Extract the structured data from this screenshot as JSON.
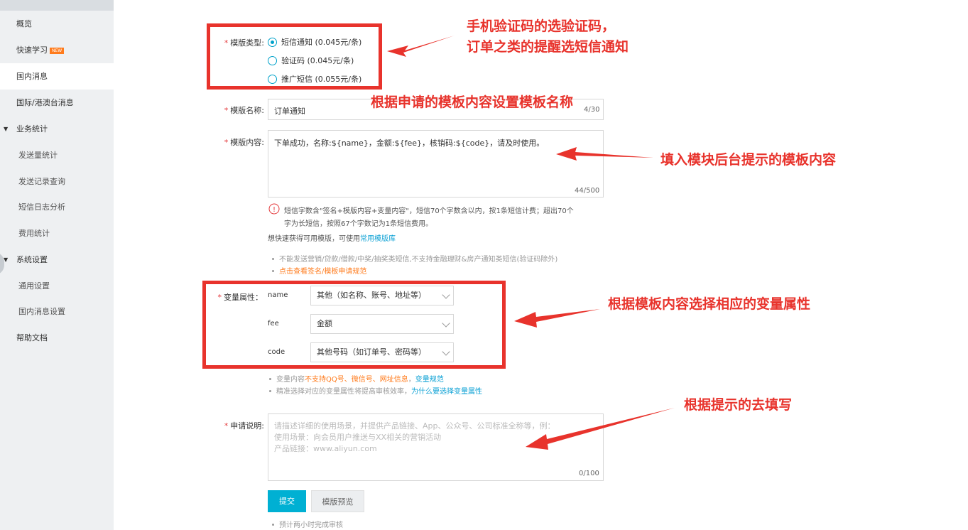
{
  "sidebar": {
    "items": [
      {
        "label": "概览"
      },
      {
        "label": "快速学习",
        "badge": "NEW"
      },
      {
        "label": "国内消息"
      },
      {
        "label": "国际/港澳台消息"
      },
      {
        "label": "业务统计"
      },
      {
        "label": "发送量统计"
      },
      {
        "label": "发送记录查询"
      },
      {
        "label": "短信日志分析"
      },
      {
        "label": "费用统计"
      },
      {
        "label": "系统设置"
      },
      {
        "label": "通用设置"
      },
      {
        "label": "国内消息设置"
      },
      {
        "label": "帮助文档"
      }
    ]
  },
  "form": {
    "required_mark": "*",
    "template_type": {
      "label": "模版类型:",
      "options": [
        "短信通知 (0.045元/条)",
        "验证码 (0.045元/条)",
        "推广短信 (0.055元/条)"
      ],
      "selected": "短信通知 (0.045元/条)"
    },
    "template_name": {
      "label": "模版名称:",
      "value": "订单通知",
      "counter_partial": "4/30"
    },
    "template_content": {
      "label": "模版内容:",
      "value": "下单成功，名称:${name}，金额:${fee}，核销码:${code}，请及时使用。",
      "counter": "44/500"
    },
    "content_tip_line1": "短信字数含\"签名+模版内容+变量内容\"，短信70个字数含以内，按1条短信计费；超出70个",
    "content_tip_line2": "字为长短信，按照67个字数记为1条短信费用。",
    "quick_template_text": "想快速获得可用模版，可使用",
    "quick_template_link": "常用模版库",
    "rule1": "不能发送营销/贷款/借款/中奖/抽奖类短信,不支持金融理财&房产通知类短信(验证码除外)",
    "rule2": "点击查看签名/模板申请规范",
    "variables": {
      "label": "变量属性：",
      "rows": [
        {
          "name": "name",
          "value": "其他（如名称、账号、地址等）"
        },
        {
          "name": "fee",
          "value": "金额"
        },
        {
          "name": "code",
          "value": "其他号码（如订单号、密码等）"
        }
      ]
    },
    "var_tip1_prefix": "变量内容",
    "var_tip1_warn": "不支持QQ号、微信号、网址信息",
    "var_tip1_sep": "，",
    "var_tip1_link": "变量规范",
    "var_tip2_text": "精准选择对应的变量属性将提高审核效率，",
    "var_tip2_link": "为什么要选择变量属性",
    "application": {
      "label": "申请说明:",
      "placeholder_line1": "请描述详细的使用场景，并提供产品链接、App、公众号、公司标准全称等，例：",
      "placeholder_line2": "使用场景：向会员用户推送与XX相关的营销活动",
      "placeholder_line3": "产品链接：www.aliyun.com",
      "counter": "0/100"
    },
    "submit_label": "提交",
    "preview_label": "模版预览",
    "eta": "预计两小时完成审核"
  },
  "annotations": {
    "type_line1": "手机验证码的选验证码，",
    "type_line2": "订单之类的提醒选短信通知",
    "name": "根据申请的模板内容设置模板名称",
    "content": "填入模块后台提示的模板内容",
    "variables": "根据模板内容选择相应的变量属性",
    "application": "根据提示的去填写"
  },
  "colors": {
    "annotation": "#e8332c",
    "accent": "#00b0d3",
    "link": "#0aa0d4",
    "warn": "#ff7b1c"
  }
}
